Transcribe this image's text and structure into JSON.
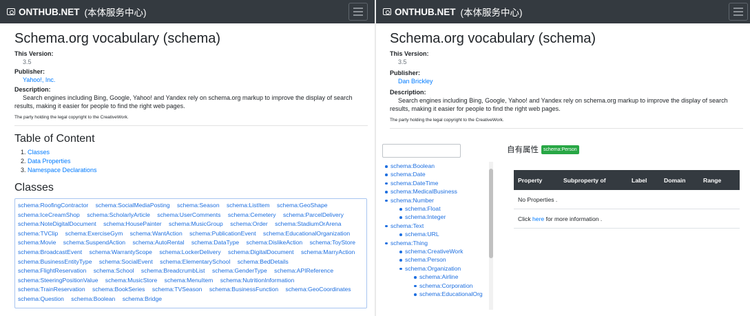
{
  "brand": {
    "text": "ONTHUB.NET",
    "cn": "(本体服务中心)"
  },
  "ontology": {
    "title": "Schema.org vocabulary (schema)",
    "version_label": "This Version:",
    "version_value": "3.5",
    "publisher_label": "Publisher:",
    "publisher_left": "Yahoo!, Inc.",
    "publisher_right": "Dan Brickley",
    "description_label": "Description:",
    "description_text": "Search engines including Bing, Google, Yahoo! and Yandex rely on schema.org markup to improve the display of search results, making it easier for people to find the right web pages.",
    "note": "The party holding the legal copyright to the CreativeWork."
  },
  "toc": {
    "heading": "Table of Content",
    "items": [
      "Classes",
      "Data Properties",
      "Namespace Declarations"
    ]
  },
  "classes": {
    "heading": "Classes",
    "items": [
      "schema:RoofingContractor",
      "schema:SocialMediaPosting",
      "schema:Season",
      "schema:ListItem",
      "schema:GeoShape",
      "schema:IceCreamShop",
      "schema:ScholarlyArticle",
      "schema:UserComments",
      "schema:Cemetery",
      "schema:ParcelDelivery",
      "schema:NoteDigitalDocument",
      "schema:HousePainter",
      "schema:MusicGroup",
      "schema:Order",
      "schema:StadiumOrArena",
      "schema:TVClip",
      "schema:ExerciseGym",
      "schema:WantAction",
      "schema:PublicationEvent",
      "schema:EducationalOrganization",
      "schema:Movie",
      "schema:SuspendAction",
      "schema:AutoRental",
      "schema:DataType",
      "schema:DislikeAction",
      "schema:ToyStore",
      "schema:BroadcastEvent",
      "schema:WarrantyScope",
      "schema:LockerDelivery",
      "schema:DigitalDocument",
      "schema:MarryAction",
      "schema:BusinessEntityType",
      "schema:SocialEvent",
      "schema:ElementarySchool",
      "schema:BedDetails",
      "schema:FlightReservation",
      "schema:School",
      "schema:BreadcrumbList",
      "schema:GenderType",
      "schema:APIReference",
      "schema:SteeringPositionValue",
      "schema:MusicStore",
      "schema:MenuItem",
      "schema:NutritionInformation",
      "schema:TrainReservation",
      "schema:BookSeries",
      "schema:TVSeason",
      "schema:BusinessFunction",
      "schema:GeoCoordinates",
      "schema:Question",
      "schema:Boolean",
      "schema:Bridge"
    ]
  },
  "tree": {
    "items": [
      {
        "label": "schema:Boolean"
      },
      {
        "label": "schema:Date"
      },
      {
        "label": "schema:DateTime"
      },
      {
        "label": "schema:MedicalBusiness"
      },
      {
        "label": "schema:Number",
        "children": [
          {
            "label": "schema:Float"
          },
          {
            "label": "schema:Integer"
          }
        ]
      },
      {
        "label": "schema:Text",
        "children": [
          {
            "label": "schema:URL"
          }
        ]
      },
      {
        "label": "schema:Thing",
        "children": [
          {
            "label": "schema:CreativeWork"
          },
          {
            "label": "schema:Person"
          },
          {
            "label": "schema:Organization",
            "children": [
              {
                "label": "schema:Airline"
              },
              {
                "label": "schema:Corporation"
              },
              {
                "label": "schema:EducationalOrg"
              }
            ]
          }
        ]
      }
    ]
  },
  "properties": {
    "heading": "自有属性",
    "badge": "schema:Person",
    "columns": [
      "Property",
      "Subproperty of",
      "Label",
      "Domain",
      "Range"
    ],
    "empty_text": "No Properties .",
    "more_prefix": "Click",
    "more_link": "here",
    "more_suffix": "for more information ."
  }
}
